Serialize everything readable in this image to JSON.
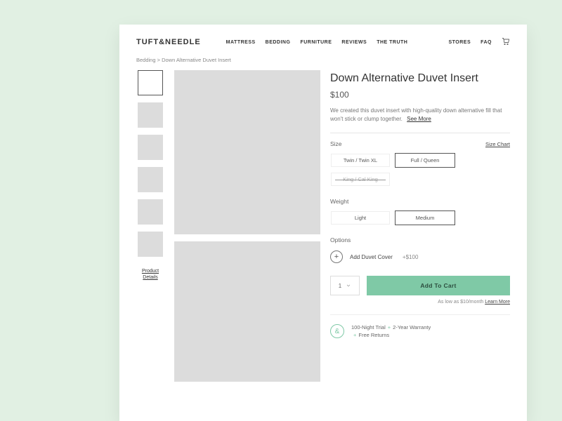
{
  "brand": "TUFT&NEEDLE",
  "nav": {
    "main": [
      "MATTRESS",
      "BEDDING",
      "FURNITURE",
      "REVIEWS",
      "THE TRUTH"
    ],
    "right": [
      "STORES",
      "FAQ"
    ]
  },
  "breadcrumb": "Bedding > Down Alternative Duvet Insert",
  "thumb_link_l1": "Product",
  "thumb_link_l2": "Details",
  "product": {
    "title": "Down Alternative Duvet Insert",
    "price": "$100",
    "description": "We created this duvet insert with high-quality down alternative fill that won't stick or clump together.",
    "see_more": "See More"
  },
  "size": {
    "label": "Size",
    "chart": "Size Chart",
    "options": [
      "Twin / Twin XL",
      "Full / Queen",
      "King / Cal King"
    ],
    "selected_index": 1,
    "unavailable_index": 2
  },
  "weight": {
    "label": "Weight",
    "options": [
      "Light",
      "Medium"
    ],
    "selected_index": 1
  },
  "options": {
    "label": "Options",
    "addon_label": "Add Duvet Cover",
    "addon_price": "+$100"
  },
  "cart": {
    "qty": "1",
    "button": "Add To Cart",
    "finance_prefix": "As low as $10/month ",
    "finance_link": "Learn More"
  },
  "badges": {
    "b1": "100-Night Trial",
    "b2": "2-Year Warranty",
    "b3": "Free Returns"
  }
}
